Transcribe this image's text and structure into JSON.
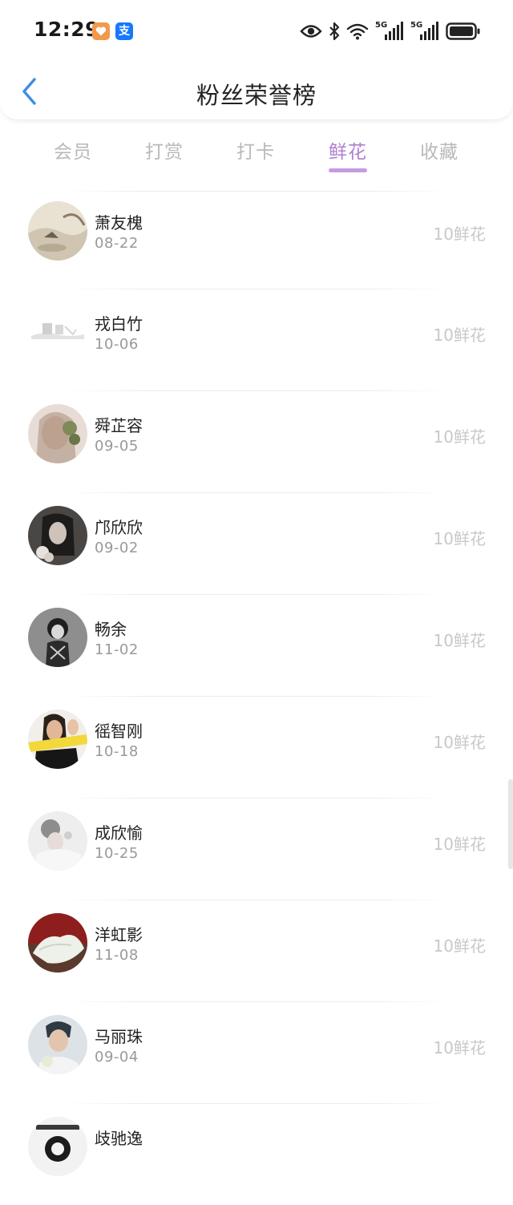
{
  "status_bar": {
    "time": "12:29",
    "badge_alipay": "支",
    "network": "5G"
  },
  "header": {
    "title": "粉丝荣誉榜"
  },
  "tabs": [
    {
      "label": "会员",
      "active": false
    },
    {
      "label": "打赏",
      "active": false
    },
    {
      "label": "打卡",
      "active": false
    },
    {
      "label": "鲜花",
      "active": true
    },
    {
      "label": "收藏",
      "active": false
    }
  ],
  "fans": [
    {
      "name": "萧友槐",
      "date": "08-22",
      "amount": "10鲜花"
    },
    {
      "name": "戎白竹",
      "date": "10-06",
      "amount": "10鲜花"
    },
    {
      "name": "舜芷容",
      "date": "09-05",
      "amount": "10鲜花"
    },
    {
      "name": "邝欣欣",
      "date": "09-02",
      "amount": "10鲜花"
    },
    {
      "name": "畅余",
      "date": "11-02",
      "amount": "10鲜花"
    },
    {
      "name": "徭智刚",
      "date": "10-18",
      "amount": "10鲜花"
    },
    {
      "name": "成欣愉",
      "date": "10-25",
      "amount": "10鲜花"
    },
    {
      "name": "洋虹影",
      "date": "11-08",
      "amount": "10鲜花"
    },
    {
      "name": "马丽珠",
      "date": "09-04",
      "amount": "10鲜花"
    },
    {
      "name": "歧驰逸",
      "date": "",
      "amount": ""
    }
  ],
  "colors": {
    "accent": "#b07fd0",
    "indicator": "#c69be0",
    "back_arrow": "#3e8ee0",
    "inactive_tab": "#b9b9b9",
    "muted_text": "#999999"
  },
  "icons": {
    "back": "chevron-left-icon",
    "eye": "eye-icon",
    "bluetooth": "bluetooth-icon",
    "wifi": "wifi-icon",
    "signal": "cellular-signal-icon",
    "battery": "battery-icon"
  }
}
